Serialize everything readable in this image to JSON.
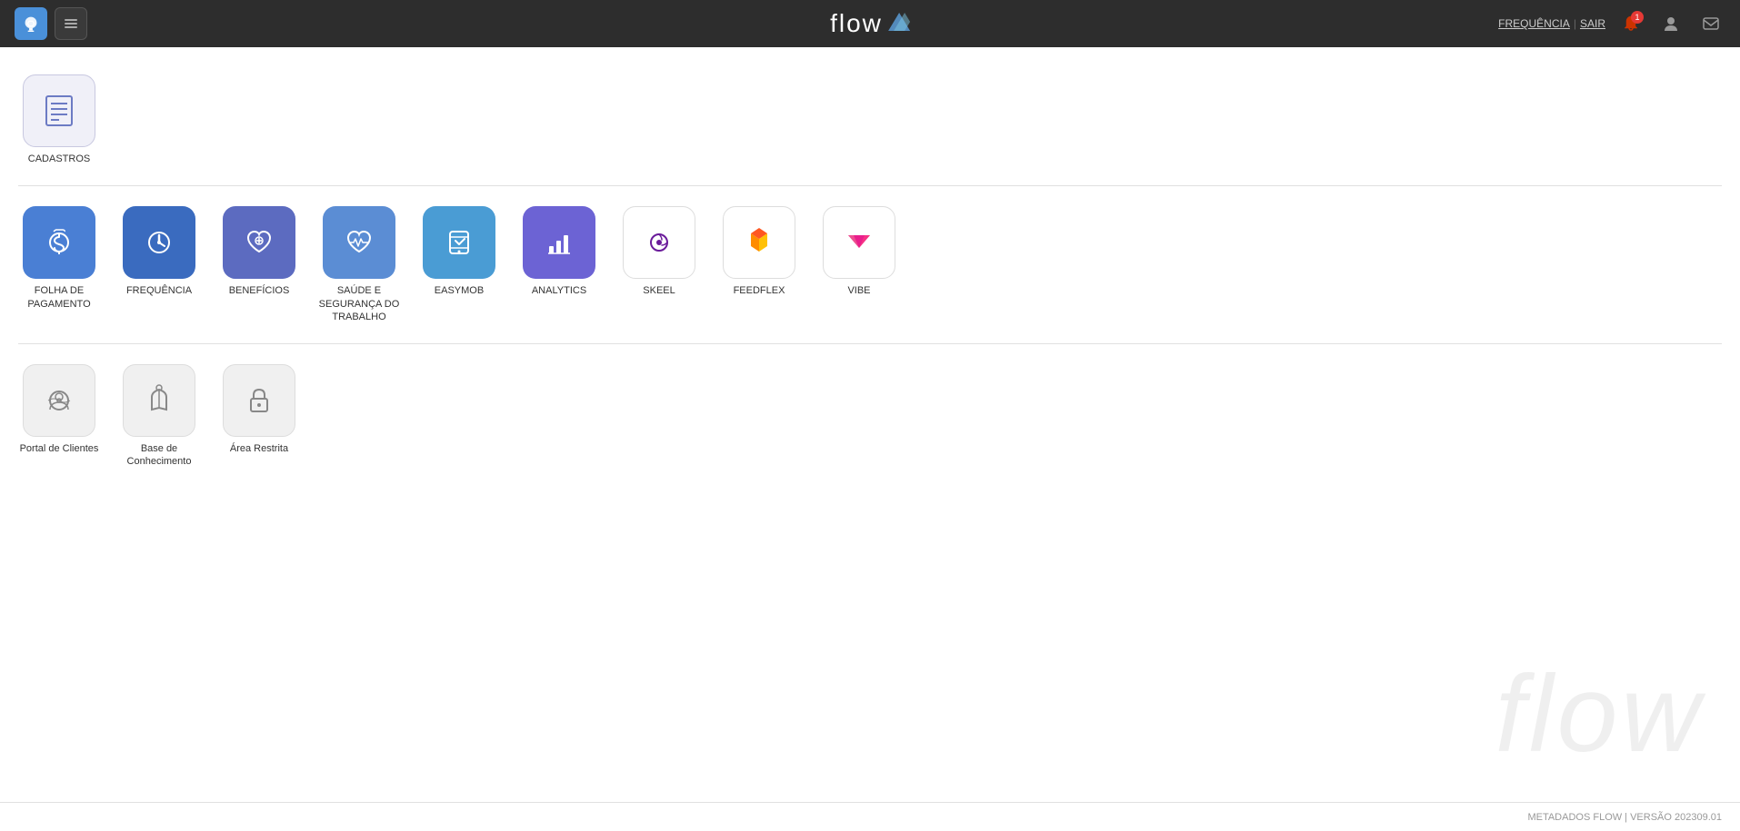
{
  "header": {
    "title": "flow",
    "frequencia_label": "FREQUÊNCIA",
    "sair_label": "SAIR",
    "separator": "|",
    "notification_count": "1"
  },
  "sections": [
    {
      "id": "cadastros",
      "apps": [
        {
          "id": "cadastros",
          "label": "CADASTROS",
          "icon_type": "cadastros"
        }
      ]
    },
    {
      "id": "produtos",
      "apps": [
        {
          "id": "folha",
          "label": "FOLHA DE PAGAMENTO",
          "icon_type": "folha"
        },
        {
          "id": "frequencia",
          "label": "FREQUÊNCIA",
          "icon_type": "frequencia"
        },
        {
          "id": "beneficios",
          "label": "BENEFÍCIOS",
          "icon_type": "beneficios"
        },
        {
          "id": "saude",
          "label": "SAÚDE E SEGURANÇA DO TRABALHO",
          "icon_type": "saude"
        },
        {
          "id": "easymob",
          "label": "EASYMOB",
          "icon_type": "easymob"
        },
        {
          "id": "analytics",
          "label": "ANALYTICS",
          "icon_type": "analytics"
        },
        {
          "id": "skeel",
          "label": "SKEEL",
          "icon_type": "skeel"
        },
        {
          "id": "feedflex",
          "label": "FEEDFLEX",
          "icon_type": "feedflex"
        },
        {
          "id": "vibe",
          "label": "VIBE",
          "icon_type": "vibe"
        }
      ]
    },
    {
      "id": "outros",
      "apps": [
        {
          "id": "portal",
          "label": "Portal de Clientes",
          "icon_type": "portal"
        },
        {
          "id": "base",
          "label": "Base de Conhecimento",
          "icon_type": "base"
        },
        {
          "id": "restrita",
          "label": "Área Restrita",
          "icon_type": "restrita"
        }
      ]
    }
  ],
  "footer": {
    "text": "METADADOS FLOW | VERSÃO 202309.01"
  }
}
